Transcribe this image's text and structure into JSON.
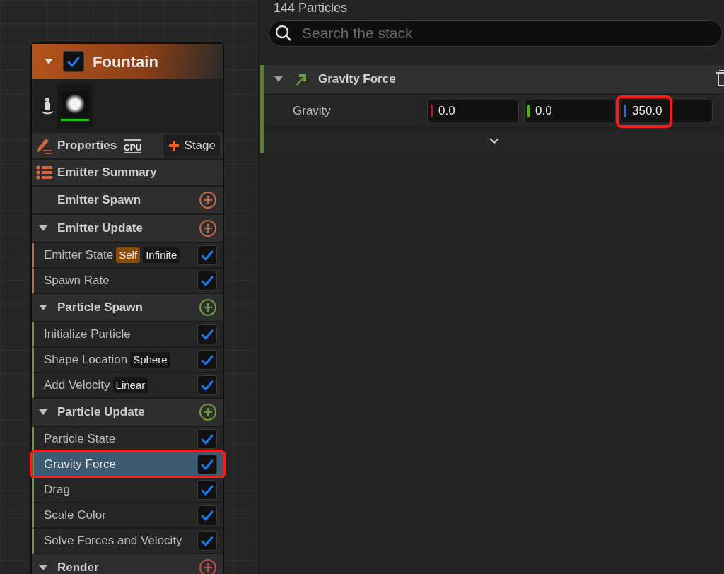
{
  "emitter": {
    "title": "Fountain",
    "expanded": true,
    "enabled": true,
    "properties": {
      "label": "Properties",
      "sim_target": "CPU",
      "stage_button": "Stage"
    },
    "stages": [
      {
        "kind": "summary",
        "label": "Emitter Summary"
      },
      {
        "kind": "plain",
        "label": "Emitter Spawn",
        "color": "#c0664a"
      },
      {
        "kind": "group",
        "label": "Emitter Update",
        "expanded": true,
        "color": "#c0664a",
        "modules": [
          {
            "label": "Emitter State",
            "enabled": true,
            "selected": false,
            "annotated": false,
            "badges": [
              {
                "text": "Self",
                "kind": "source"
              },
              {
                "text": "Infinite",
                "kind": "value"
              }
            ]
          },
          {
            "label": "Spawn Rate",
            "enabled": true,
            "selected": false,
            "annotated": false
          }
        ]
      },
      {
        "kind": "group",
        "label": "Particle Spawn",
        "expanded": true,
        "color": "#6a9a3a",
        "modules": [
          {
            "label": "Initialize Particle",
            "enabled": true,
            "selected": false,
            "annotated": false
          },
          {
            "label": "Shape Location",
            "enabled": true,
            "selected": false,
            "annotated": false,
            "badges": [
              {
                "text": "Sphere",
                "kind": "value"
              }
            ]
          },
          {
            "label": "Add Velocity",
            "enabled": true,
            "selected": false,
            "annotated": false,
            "badges": [
              {
                "text": "Linear",
                "kind": "value"
              }
            ]
          }
        ]
      },
      {
        "kind": "group",
        "label": "Particle Update",
        "expanded": true,
        "color": "#6a9a3a",
        "modules": [
          {
            "label": "Particle State",
            "enabled": true,
            "selected": false,
            "annotated": false
          },
          {
            "label": "Gravity Force",
            "enabled": true,
            "selected": true,
            "annotated": true
          },
          {
            "label": "Drag",
            "enabled": true,
            "selected": false,
            "annotated": false
          },
          {
            "label": "Scale Color",
            "enabled": true,
            "selected": false,
            "annotated": false
          },
          {
            "label": "Solve Forces and Velocity",
            "enabled": true,
            "selected": false,
            "annotated": false
          }
        ]
      },
      {
        "kind": "group",
        "label": "Render",
        "expanded": true,
        "color": "#c04a4a"
      }
    ]
  },
  "stack": {
    "particle_count": "144 Particles",
    "search": {
      "placeholder": "Search the stack"
    },
    "module": {
      "title": "Gravity Force",
      "expanded": true,
      "params": [
        {
          "label": "Gravity",
          "components": [
            {
              "value": "0.0",
              "color": "#d01010",
              "annotated": false
            },
            {
              "value": "0.0",
              "color": "#50b010",
              "annotated": false
            },
            {
              "value": "350.0",
              "color": "#1070f0",
              "annotated": true
            }
          ]
        }
      ]
    }
  }
}
